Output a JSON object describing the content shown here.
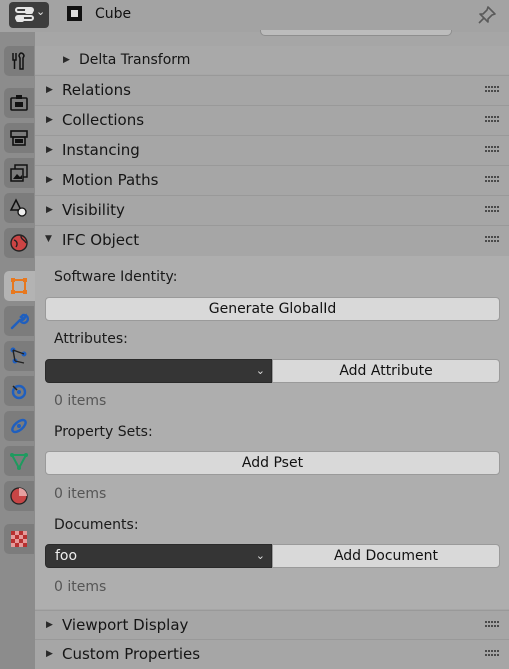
{
  "header": {
    "object_name": "Cube",
    "editor_icon": "properties-editor-icon",
    "object_icon": "cube-object-icon",
    "pin_icon": "pin-icon"
  },
  "tabs": [
    {
      "name": "tool",
      "icon": "wrench-screwdriver-icon",
      "active": false
    },
    {
      "name": "render",
      "icon": "camera-back-icon",
      "active": false
    },
    {
      "name": "output",
      "icon": "printer-icon",
      "active": false
    },
    {
      "name": "view-layer",
      "icon": "image-stack-icon",
      "active": false
    },
    {
      "name": "scene",
      "icon": "cone-sphere-icon",
      "active": false
    },
    {
      "name": "world",
      "icon": "globe-icon",
      "active": false
    },
    {
      "name": "object",
      "icon": "square-object-icon",
      "active": true
    },
    {
      "name": "modifiers",
      "icon": "wrench-icon",
      "active": false
    },
    {
      "name": "particles",
      "icon": "particles-icon",
      "active": false
    },
    {
      "name": "physics",
      "icon": "physics-orbit-icon",
      "active": false
    },
    {
      "name": "constraints",
      "icon": "constraint-icon",
      "active": false
    },
    {
      "name": "data",
      "icon": "mesh-triangle-icon",
      "active": false
    },
    {
      "name": "material",
      "icon": "material-sphere-icon",
      "active": false
    },
    {
      "name": "texture",
      "icon": "checker-texture-icon",
      "active": false
    }
  ],
  "panels": {
    "delta_transform": "Delta Transform",
    "relations": "Relations",
    "collections": "Collections",
    "instancing": "Instancing",
    "motion_paths": "Motion Paths",
    "visibility": "Visibility",
    "ifc_object": "IFC Object",
    "viewport_display": "Viewport Display",
    "custom_properties": "Custom Properties"
  },
  "ifc": {
    "software_identity_label": "Software Identity:",
    "generate_globalid_button": "Generate GlobalId",
    "attributes_label": "Attributes:",
    "attribute_dropdown_value": "",
    "add_attribute_button": "Add Attribute",
    "attributes_count": "0 items",
    "property_sets_label": "Property Sets:",
    "add_pset_button": "Add Pset",
    "psets_count": "0 items",
    "documents_label": "Documents:",
    "document_dropdown_value": "foo",
    "add_document_button": "Add Document",
    "documents_count": "0 items"
  },
  "colors": {
    "active_tab_orange": "#e8781e",
    "dropdown_bg": "#353535"
  }
}
